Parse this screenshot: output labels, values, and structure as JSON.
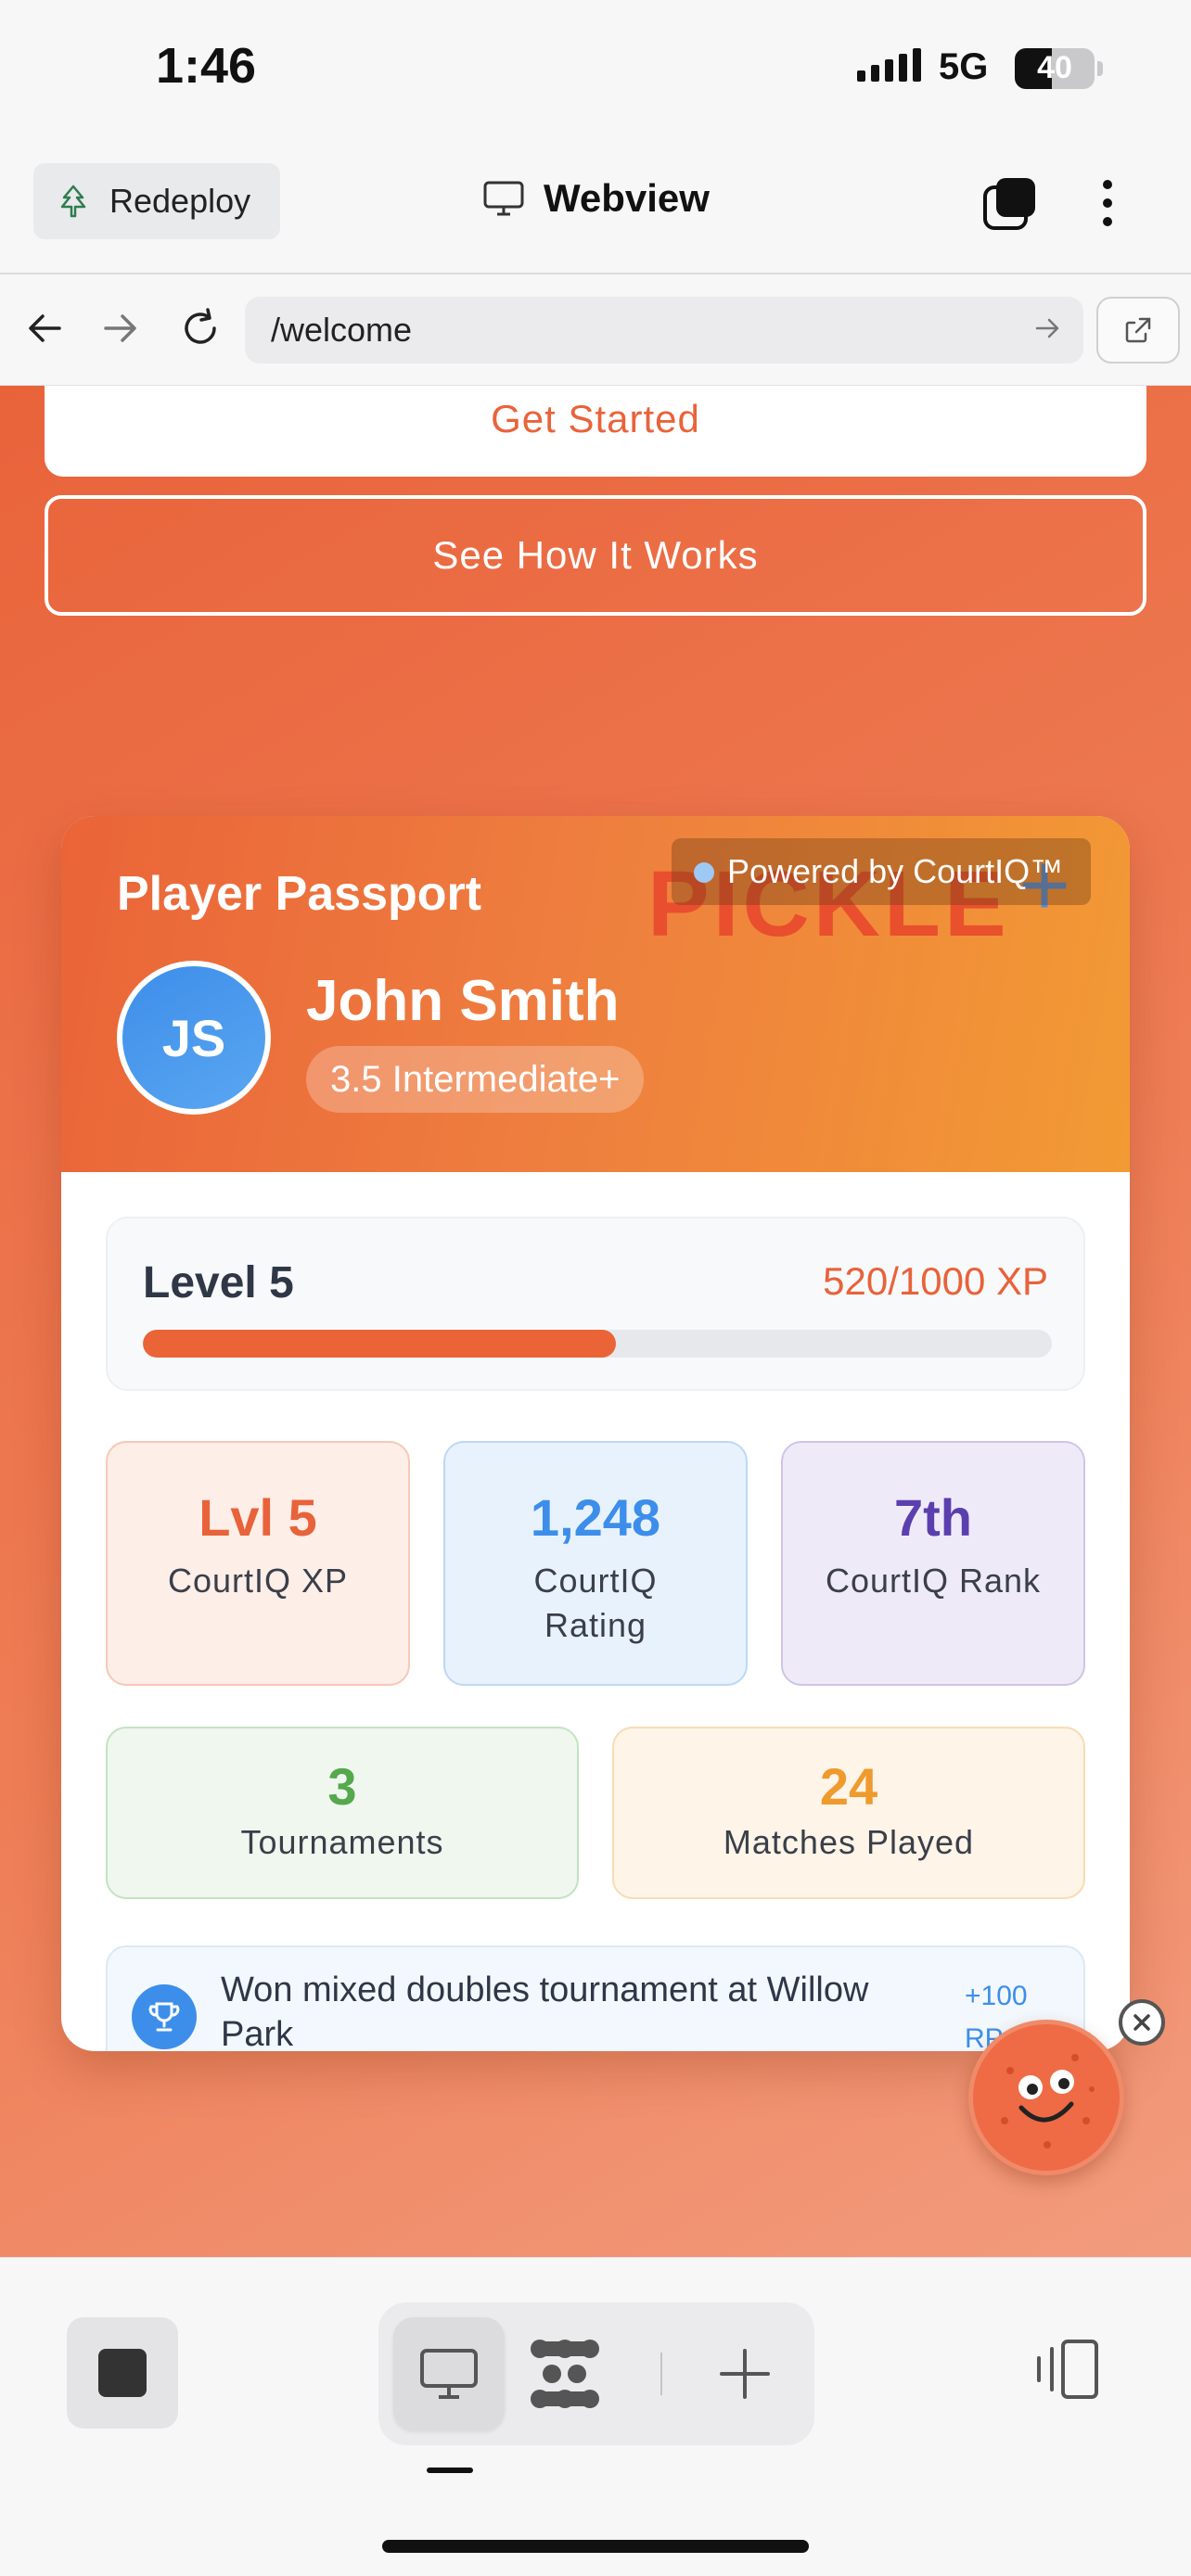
{
  "status": {
    "time": "1:46",
    "network": "5G",
    "battery": "40"
  },
  "appbar": {
    "redeploy_label": "Redeploy",
    "title": "Webview"
  },
  "browser": {
    "url": "/welcome"
  },
  "hero": {
    "get_started": "Get Started",
    "see_how": "See How It Works"
  },
  "passport": {
    "title": "Player Passport",
    "watermark": "PICKLE",
    "powered_by": "Powered by CourtIQ™",
    "initials": "JS",
    "name": "John Smith",
    "skill": "3.5 Intermediate+",
    "level_label": "Level 5",
    "xp_text": "520/1000 XP",
    "xp_progress": 0.52,
    "stats": [
      {
        "value": "Lvl 5",
        "label": "CourtIQ XP"
      },
      {
        "value": "1,248",
        "label": "CourtIQ Rating"
      },
      {
        "value": "7th",
        "label": "CourtIQ Rank"
      },
      {
        "value": "3",
        "label": "Tournaments"
      },
      {
        "value": "24",
        "label": "Matches Played"
      }
    ],
    "activity": {
      "text": "Won mixed doubles tournament at Willow Park",
      "points": "+100 RP"
    }
  },
  "colors": {
    "accent": "#e9633a",
    "blue": "#3d8eea",
    "purple": "#5b3fae",
    "green": "#55a84c",
    "amber": "#ef9a2d"
  },
  "icons": [
    "tree-icon",
    "monitor-icon",
    "tabs-icon",
    "kebab-icon",
    "back-icon",
    "forward-icon",
    "reload-icon",
    "go-arrow-icon",
    "external-link-icon",
    "trophy-icon",
    "chevron-down-icon",
    "close-icon",
    "stop-icon",
    "desktop-icon",
    "grid-icon",
    "plus-icon",
    "side-panel-icon"
  ]
}
